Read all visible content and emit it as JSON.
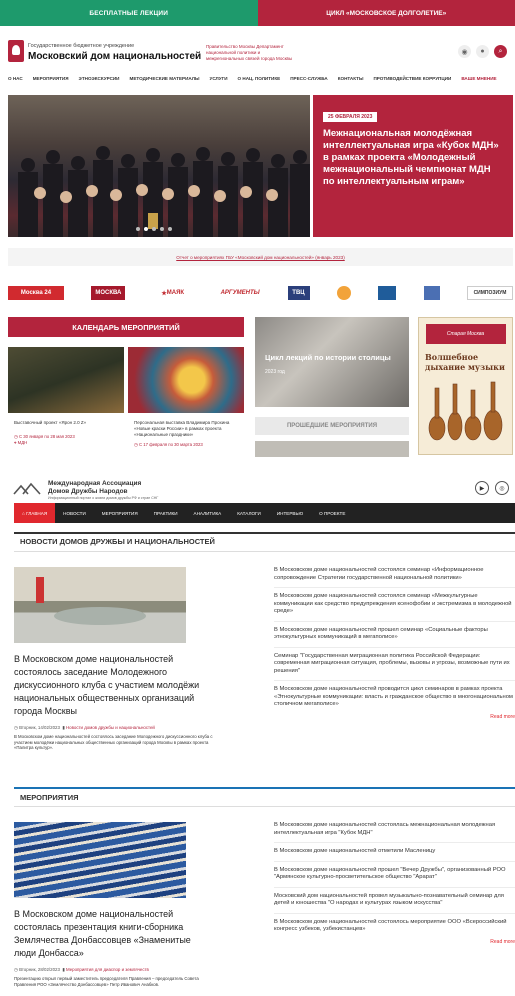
{
  "top_strip": {
    "left": "БЕСПЛАТНЫЕ ЛЕКЦИИ",
    "right": "ЦИКЛ «МОСКОВСКОЕ ДОЛГОЛЕТИЕ»"
  },
  "header": {
    "org_sub": "Государственное бюджетное учреждение",
    "org_main": "Московский дом национальностей",
    "dept": "Правительство Москвы Департамент национальной политики и межрегиональных связей города Москвы"
  },
  "main_nav": [
    "О НАС",
    "МЕРОПРИЯТИЯ",
    "ЭТНОЭКСКУРСИИ",
    "МЕТОДИЧЕСКИЕ МАТЕРИАЛЫ",
    "УСЛУГИ",
    "О НАЦ. ПОЛИТИКЕ",
    "ПРЕСС-СЛУЖБА",
    "КОНТАКТЫ",
    "ПРОТИВОДЕЙСТВИЕ КОРРУПЦИИ",
    "ВАШЕ МНЕНИЕ"
  ],
  "hero": {
    "date": "25 ФЕВРАЛЯ 2023",
    "title": "Межнациональная молодёжная интеллектуальная игра «Кубок МДН» в рамках проекта «Молодежный межнациональный чемпионат МДН по интеллектуальным играм»"
  },
  "report_link": "Отчет о мероприятиях ГБУ «Московский дом национальностей» (январь 2023)",
  "partners": [
    "Москва 24",
    "МОСКВА",
    "МАЯК",
    "АРГУМЕНТЫ",
    "ТВЦ",
    "",
    "",
    "",
    "СИМПОЗИУМ"
  ],
  "calendar": {
    "heading": "КАЛЕНДАРЬ МЕРОПРИЯТИЙ",
    "events": [
      {
        "caption": "Выставочный проект «Ярон 2.0 Z»",
        "date": "С 30 января по 28 мая 2023",
        "place": "МДН"
      },
      {
        "caption": "Персональная выставка Владимира Прохина «Новые краски России» в рамках проекта «Национальные праздники»",
        "date": "С 17 февраля по 30 марта 2023"
      }
    ]
  },
  "lecture": {
    "title": "Цикл лекций по истории столицы",
    "year": "2023 год"
  },
  "past_events": "ПРОШЕДШИЕ МЕРОПРИЯТИЯ",
  "music": {
    "logo": "Старая Москва",
    "title": "Волшебное дыхание музыки"
  },
  "mad": {
    "line1": "Международная Ассоциация",
    "line2": "Домов Дружбы Народов",
    "line3": "Информационный портал о жизни домов дружбы РФ и стран СНГ"
  },
  "dark_nav": [
    "ГЛАВНАЯ",
    "НОВОСТИ",
    "МЕРОПРИЯТИЯ",
    "ПРАКТИКИ",
    "АНАЛИТИКА",
    "КАТАЛОГИ",
    "ИНТЕРВЬЮ",
    "О ПРОЕКТЕ"
  ],
  "news_section": {
    "heading": "НОВОСТИ ДОМОВ ДРУЖБЫ И НАЦИОНАЛЬНОСТЕЙ",
    "main": {
      "title": "В Московском доме национальностей состоялось заседание Молодежного дискуссионного клуба с участием молодёжи национальных общественных организаций города Москвы",
      "date": "Вторник, 14/02/2023",
      "category": "Новости домов дружбы и национальностей",
      "excerpt": "В Московском доме национальностей состоялось заседание Молодежного дискуссионного клуба с участием молодёжи национальных общественных организаций города Москвы в рамках проекта «Палитра культур»."
    },
    "list": [
      "В Московском доме национальностей состоялся семинар «Информационное сопровождение Стратегии государственной национальной политики»",
      "В Московском доме национальностей состоялся семинар «Межкультурные коммуникации как средство предупреждения ксенофобии и экстремизма в молодежной среде»",
      "В Московском доме национальностей прошел семинар «Социальные факторы этнокультурных коммуникаций в мегаполисе»",
      "Семинар \"Государственная миграционная политика Российской Федерации: современная миграционная ситуация, проблемы, вызовы и угрозы, возможные пути их решения\"",
      "В Московском доме национальностей проводится цикл семинаров в рамках проекта «Этнокультурные коммуникации: власть и гражданское общество в многонациональном столичном мегаполисе»"
    ],
    "read_more": "Read more"
  },
  "events_section": {
    "heading": "МЕРОПРИЯТИЯ",
    "main": {
      "title": "В Московском доме национальностей состоялась презентация книги-сборника Землячества Донбассовцев «Знаменитые люди Донбасса»",
      "date": "Вторник, 28/02/2023",
      "category": "Мероприятия для диаспор и землячеств",
      "excerpt": "Презентацию открыл первый заместитель председателя Правления – председатель Совета Правления РОО «Землячество Донбассовцев» Петр Иванович Анабков."
    },
    "list": [
      "В Московском доме национальностей состоялась межнациональная молодежная интеллектуальная игра \"Кубок МДН\"",
      "В Московском доме национальностей отметили Масленицу",
      "В Московском доме национальностей прошел \"Вечер Дружбы\", организованный РОО \"Армянское культурно-просветительское общество \"Арарат\"",
      "Московский дом национальностей провел музыкально-познавательный семинар для детей и юношества \"О народах и культурах языком искусства\"",
      "В Московском доме национальностей состоялось мероприятие ООО «Всероссийский конгресс узбеков, узбекистанцев»"
    ],
    "read_more": "Read more"
  }
}
